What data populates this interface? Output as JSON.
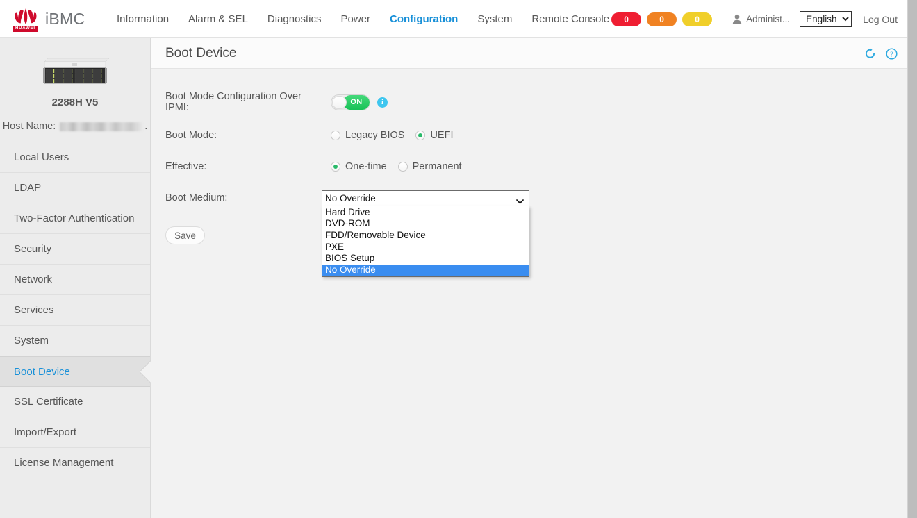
{
  "brand": {
    "logo_icon": "huawei-flower-logo",
    "logo_word": "HUAWEI",
    "product": "iBMC"
  },
  "topnav": {
    "items": [
      {
        "label": "Information",
        "active": false
      },
      {
        "label": "Alarm & SEL",
        "active": false
      },
      {
        "label": "Diagnostics",
        "active": false
      },
      {
        "label": "Power",
        "active": false
      },
      {
        "label": "Configuration",
        "active": true
      },
      {
        "label": "System",
        "active": false
      },
      {
        "label": "Remote Console",
        "active": false
      }
    ]
  },
  "topright": {
    "badges": [
      {
        "name": "critical-alarm-badge",
        "value": "0",
        "color": "#ef1e32"
      },
      {
        "name": "major-alarm-badge",
        "value": "0",
        "color": "#f08222"
      },
      {
        "name": "minor-alarm-badge",
        "value": "0",
        "color": "#f0cf2a"
      }
    ],
    "user_icon": "person-icon",
    "user_name": "Administ...",
    "language": "English",
    "language_options": [
      "English"
    ],
    "logout_label": "Log Out"
  },
  "sidebar": {
    "server_image_alt": "rack-server-thumbnail",
    "model": "2288H V5",
    "host_name_label": "Host Name:",
    "host_name_value": "",
    "host_name_redacted": true,
    "host_name_suffix": ".",
    "items": [
      {
        "label": "Local Users",
        "active": false
      },
      {
        "label": "LDAP",
        "active": false
      },
      {
        "label": "Two-Factor Authentication",
        "active": false
      },
      {
        "label": "Security",
        "active": false
      },
      {
        "label": "Network",
        "active": false
      },
      {
        "label": "Services",
        "active": false
      },
      {
        "label": "System",
        "active": false
      },
      {
        "label": "Boot Device",
        "active": true
      },
      {
        "label": "SSL Certificate",
        "active": false
      },
      {
        "label": "Import/Export",
        "active": false
      },
      {
        "label": "License Management",
        "active": false
      }
    ]
  },
  "page": {
    "title": "Boot Device",
    "refresh_icon": "refresh-icon",
    "help_icon": "help-icon",
    "accent_color": "#2eaae0"
  },
  "form": {
    "ipmi_row": {
      "label": "Boot Mode Configuration Over IPMI:",
      "toggle_state": "ON",
      "info_icon": "info-icon"
    },
    "boot_mode": {
      "label": "Boot Mode:",
      "options": [
        {
          "label": "Legacy BIOS",
          "checked": false
        },
        {
          "label": "UEFI",
          "checked": true
        }
      ]
    },
    "effective": {
      "label": "Effective:",
      "options": [
        {
          "label": "One-time",
          "checked": true
        },
        {
          "label": "Permanent",
          "checked": false
        }
      ]
    },
    "boot_medium": {
      "label": "Boot Medium:",
      "selected": "No Override",
      "expanded": true,
      "options": [
        {
          "label": "Hard Drive",
          "selected": false
        },
        {
          "label": "DVD-ROM",
          "selected": false
        },
        {
          "label": "FDD/Removable Device",
          "selected": false
        },
        {
          "label": "PXE",
          "selected": false
        },
        {
          "label": "BIOS Setup",
          "selected": false
        },
        {
          "label": "No Override",
          "selected": true
        }
      ]
    },
    "save_label": "Save"
  }
}
